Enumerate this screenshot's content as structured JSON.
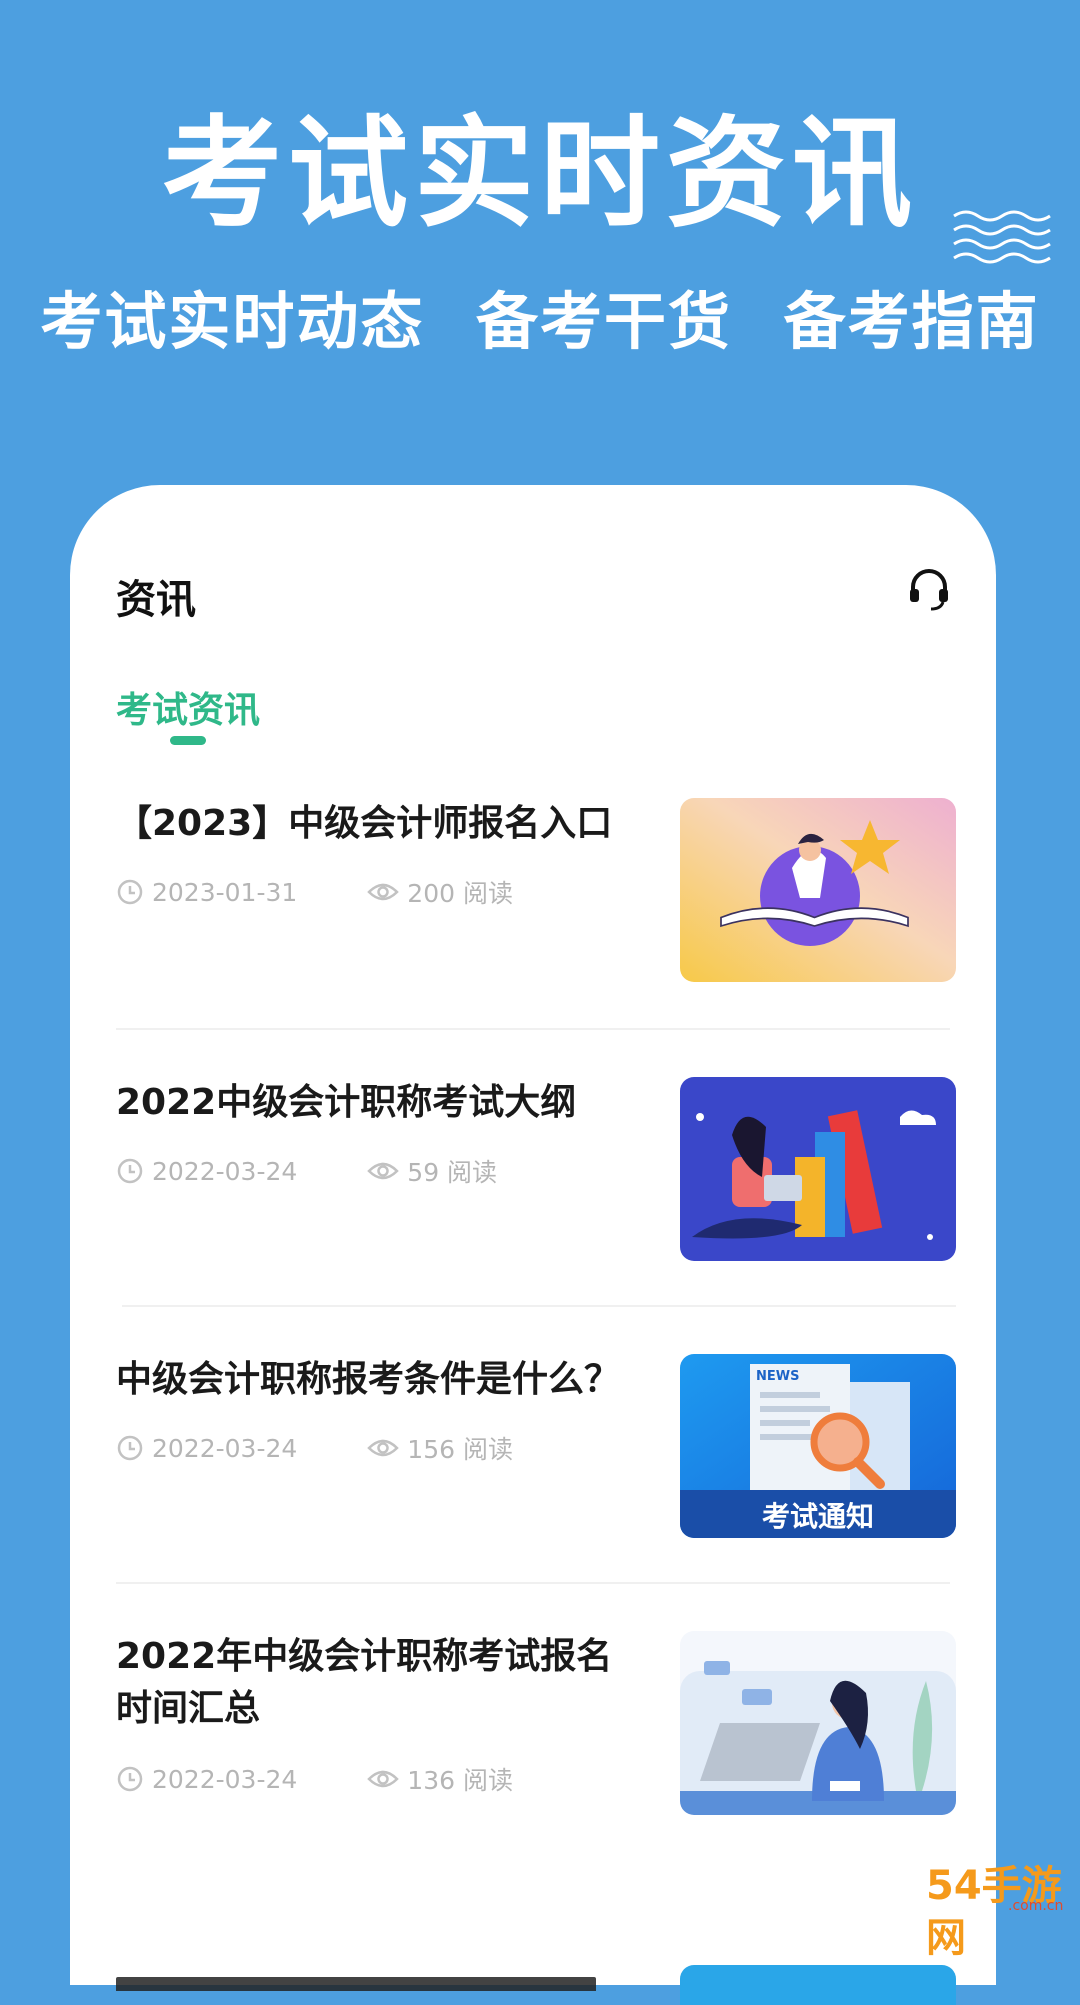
{
  "hero": {
    "title": "考试实时资讯",
    "subtitle_1": "考试实时动态",
    "subtitle_2": "备考干货",
    "subtitle_3": "备考指南"
  },
  "header": {
    "title": "资讯",
    "support_icon": "headset-icon"
  },
  "tabs": [
    {
      "label": "考试资讯",
      "active": true
    }
  ],
  "articles": [
    {
      "title": "【2023】中级会计师报名入口",
      "date": "2023-01-31",
      "views": "200 阅读",
      "thumb": "reading-girl-star"
    },
    {
      "title": "2022中级会计职称考试大纲",
      "date": "2022-03-24",
      "views": "59 阅读",
      "thumb": "girl-laptop-books"
    },
    {
      "title": "中级会计职称报考条件是什么？",
      "date": "2022-03-24",
      "views": "156 阅读",
      "thumb": "news-magnifier",
      "thumb_caption": "考试通知",
      "thumb_news": "NEWS"
    },
    {
      "title": "2022年中级会计职称考试报名时间汇总",
      "date": "2022-03-24",
      "views": "136 阅读",
      "thumb": "woman-at-computer"
    }
  ],
  "watermark": {
    "text": "54手游网",
    "domain": ".com.cn"
  },
  "colors": {
    "background": "#4d9fe0",
    "accent": "#2fb889",
    "meta": "#b5b5b5"
  }
}
